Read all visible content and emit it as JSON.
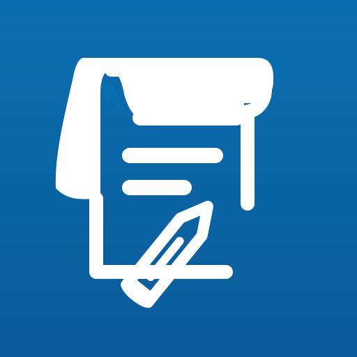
{
  "icon": {
    "name": "notes-scroll-pencil-icon",
    "colors": {
      "background_top": "#0a6fb0",
      "background_bottom": "#0a5b99",
      "foreground": "#ffffff"
    }
  }
}
